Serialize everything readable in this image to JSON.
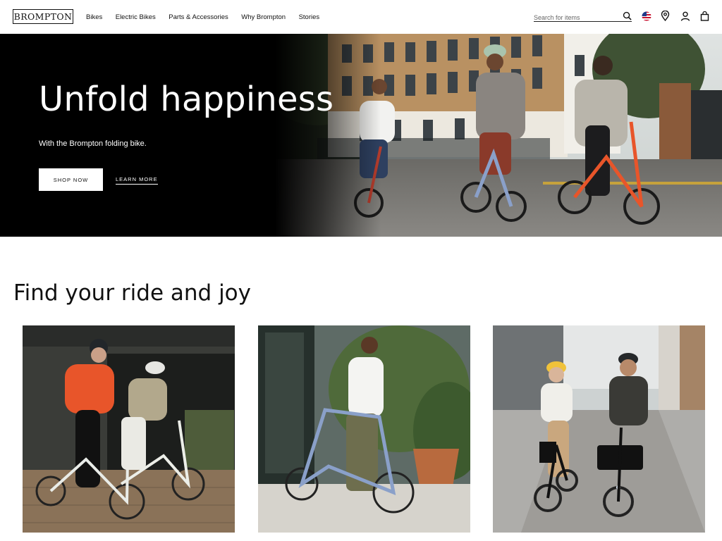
{
  "header": {
    "logo": "BROMPTON",
    "nav": [
      "Bikes",
      "Electric Bikes",
      "Parts & Accessories",
      "Why Brompton",
      "Stories"
    ],
    "search_placeholder": "Search for items",
    "icons": [
      "search-icon",
      "us-flag-icon",
      "location-pin-icon",
      "account-icon",
      "shopping-bag-icon"
    ]
  },
  "hero": {
    "title": "Unfold happiness",
    "subtitle": "With the Brompton folding bike.",
    "primary_cta": "SHOP NOW",
    "secondary_cta": "LEARN MORE"
  },
  "section": {
    "title": "Find your ride and joy"
  },
  "colors": {
    "brand_black": "#000000",
    "accent_orange": "#e8552a",
    "bike_blue": "#8aa0c9"
  }
}
